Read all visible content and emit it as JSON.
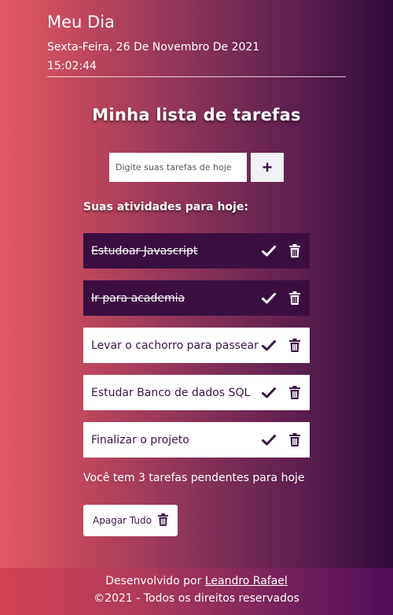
{
  "header": {
    "title": "Meu Dia",
    "date": "Sexta-Feira, 26 De Novembro De 2021",
    "time": "15:02:44"
  },
  "main": {
    "title": "Minha lista de tarefas",
    "input_placeholder": "Digite suas tarefas de hoje",
    "add_label": "+",
    "activities_heading": "Suas atividades para hoje:",
    "tasks": [
      {
        "text": "Estudoar Javascript",
        "done": true
      },
      {
        "text": "Ir para academia",
        "done": true
      },
      {
        "text": "Levar o cachorro para passear",
        "done": false
      },
      {
        "text": "Estudar Banco de dados SQL",
        "done": false
      },
      {
        "text": "Finalizar o projeto",
        "done": false
      }
    ],
    "pending_text": "Você tem 3 tarefas pendentes para hoje",
    "clear_label": "Apagar Tudo"
  },
  "footer": {
    "credit_prefix": "Desenvolvido por",
    "author": "Leandro Rafael",
    "copyright": "©2021 - Todos os direitos reservados"
  },
  "colors": {
    "done_task_bg": "#3a0f40",
    "task_text": "#3a1645"
  },
  "icons": {
    "complete": "check-icon",
    "delete": "trash-icon"
  }
}
